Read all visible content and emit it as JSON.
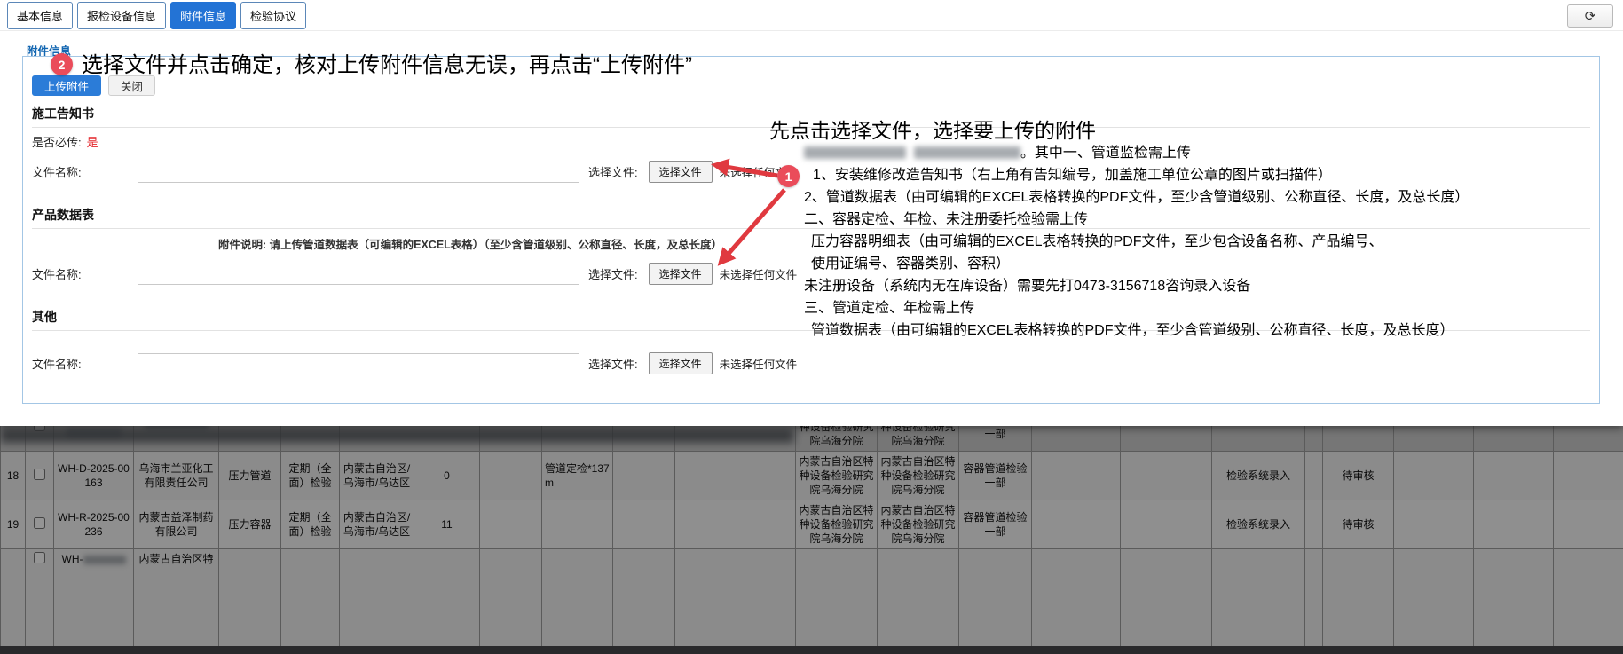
{
  "tabs": {
    "items": [
      {
        "label": "基本信息",
        "active": false
      },
      {
        "label": "报检设备信息",
        "active": false
      },
      {
        "label": "附件信息",
        "active": true
      },
      {
        "label": "检验协议",
        "active": false
      }
    ],
    "refresh_icon": "⟳"
  },
  "panel": {
    "label": "附件信息",
    "upload_button": "上传附件",
    "close_button": "关闭",
    "sections": [
      {
        "title": "施工告知书",
        "required_label": "是否必传:",
        "required_value": "是",
        "filename_label": "文件名称:",
        "filename_value": "",
        "choose_label": "选择文件:",
        "choose_button": "选择文件",
        "no_file_text": "未选择任何文件"
      },
      {
        "title": "产品数据表",
        "note": "附件说明: 请上传管道数据表（可编辑的EXCEL表格）（至少含管道级别、公称直径、长度，及总长度）",
        "filename_label": "文件名称:",
        "filename_value": "",
        "choose_label": "选择文件:",
        "choose_button": "选择文件",
        "no_file_text": "未选择任何文件"
      },
      {
        "title": "其他",
        "filename_label": "文件名称:",
        "filename_value": "",
        "choose_label": "选择文件:",
        "choose_button": "选择文件",
        "no_file_text": "未选择任何文件"
      }
    ]
  },
  "annotations": {
    "step2": {
      "number": "2",
      "text": "选择文件并点击确定，核对上传附件信息无误，再点击“上传附件”"
    },
    "step1": {
      "number": "1",
      "heading": "先点击选择文件，选择要上传的附件"
    },
    "notes_line1_suffix": "。其中一、管道监检需上传",
    "notes": [
      "1、安装维修改造告知书（右上角有告知编号，加盖施工单位公章的图片或扫描件）",
      "2、管道数据表（由可编辑的EXCEL表格转换的PDF文件，至少含管道级别、公称直径、长度，及总长度）",
      "二、容器定检、年检、未注册委托检验需上传",
      "压力容器明细表（由可编辑的EXCEL表格转换的PDF文件，至少包含设备名称、产品编号、",
      "使用证编号、容器类别、容积）",
      "未注册设备（系统内无在库设备）需要先打0473-3156718咨询录入设备",
      "三、管道定检、年检需上传",
      "管道数据表（由可编辑的EXCEL表格转换的PDF文件，至少含管道级别、公称直径、长度，及总长度）"
    ]
  },
  "background_table": {
    "partial_top_row": {
      "org1": "内蒙古自治区特种设备检验研究院乌海分院",
      "org2": "内蒙古自治区特种设备检验研究院乌海分院",
      "dept": "容器管道检验一部"
    },
    "rows": [
      {
        "seq": "18",
        "code": "WH-D-2025-00163",
        "company": "乌海市兰亚化工有限责任公司",
        "equipment_type": "压力管道",
        "inspection_type": "定期（全面）检验",
        "region": "内蒙古自治区/乌海市/乌达区",
        "count": "0",
        "note": "管道定检*137m",
        "org1": "内蒙古自治区特种设备检验研究院乌海分院",
        "org2": "内蒙古自治区特种设备检验研究院乌海分院",
        "dept": "容器管道检验一部",
        "source": "检验系统录入",
        "status": "待审核"
      },
      {
        "seq": "19",
        "code": "WH-R-2025-00236",
        "company": "内蒙古益泽制药有限公司",
        "equipment_type": "压力容器",
        "inspection_type": "定期（全面）检验",
        "region": "内蒙古自治区/乌海市/乌达区",
        "count": "11",
        "note": "",
        "org1": "内蒙古自治区特种设备检验研究院乌海分院",
        "org2": "内蒙古自治区特种设备检验研究院乌海分院",
        "dept": "容器管道检验一部",
        "source": "检验系统录入",
        "status": "待审核"
      }
    ],
    "partial_bottom_row": {
      "code_fragment": "WH-",
      "company_fragment": "内蒙古自治区特"
    }
  },
  "colors": {
    "accent_blue": "#2373d5",
    "annotation_red": "#e0393f",
    "required_red": "#e4252b",
    "label_blue": "#1266b1"
  }
}
